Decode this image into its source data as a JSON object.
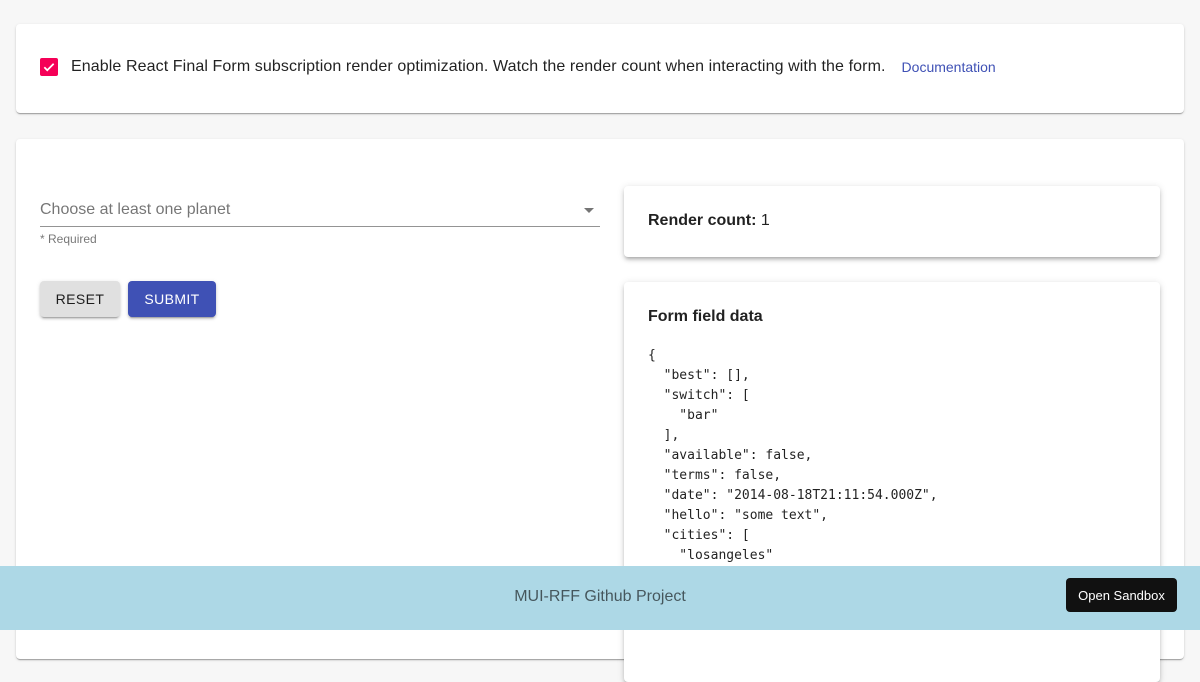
{
  "options": {
    "checkbox_checked": true,
    "checkbox_color": "#f50057",
    "optimization_label": "Enable React Final Form subscription render optimization. Watch the render count when interacting with the form.",
    "documentation_link": "Documentation"
  },
  "form": {
    "select_placeholder": "Choose at least one planet",
    "helper_text": "* Required",
    "reset_label": "RESET",
    "submit_label": "SUBMIT",
    "submit_color": "#3f51b5"
  },
  "render_count": {
    "label": "Render count:",
    "value": "1"
  },
  "form_field_data": {
    "title": "Form field data",
    "json_text": "{\n  \"best\": [],\n  \"switch\": [\n    \"bar\"\n  ],\n  \"available\": false,\n  \"terms\": false,\n  \"date\": \"2014-08-18T21:11:54.000Z\",\n  \"hello\": \"some text\",\n  \"cities\": [\n    \"losangeles\""
  },
  "footer": {
    "project_link": "MUI-RFF Github Project",
    "sandbox_label": "Open Sandbox",
    "background_color": "#add8e6"
  }
}
